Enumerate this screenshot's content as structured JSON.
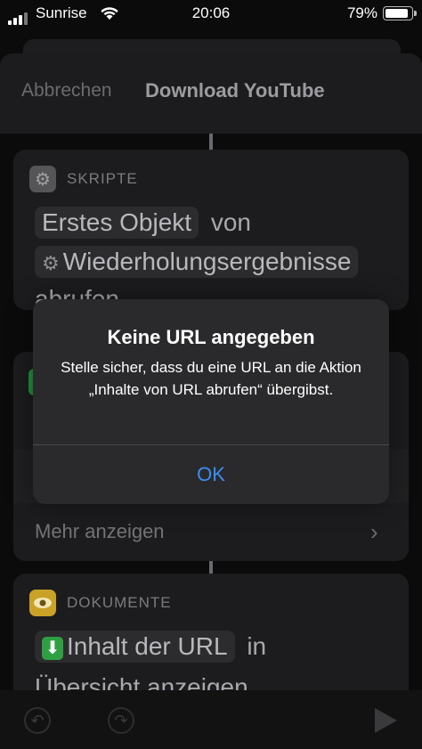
{
  "status_bar": {
    "carrier": "Sunrise",
    "time": "20:06",
    "battery": "79%"
  },
  "nav": {
    "cancel_label": "Abbrechen",
    "title": "Download YouTube"
  },
  "script_card": {
    "category": "SKRIPTE",
    "icon": "gear-icon",
    "line1_pill": "Erstes Objekt",
    "line1_word": "von",
    "line2_pill": "Wiederholungsergebnisse",
    "line3_partial": "abrufen"
  },
  "url_card": {
    "more_label": "Mehr anzeigen"
  },
  "documents_card": {
    "category": "DOKUMENTE",
    "icon": "eye-icon",
    "line1_pill": "Inhalt der URL",
    "line1_word": "in",
    "line2": "Übersicht anzeigen"
  },
  "alert": {
    "title": "Keine URL angegeben",
    "message": "Stelle sicher, dass du eine URL an die Aktion „Inhalte von URL abrufen“ übergibst.",
    "ok_label": "OK"
  },
  "colors": {
    "accent": "#3d8cf5",
    "documents_icon": "#c9a227",
    "download_icon": "#2ea043"
  }
}
